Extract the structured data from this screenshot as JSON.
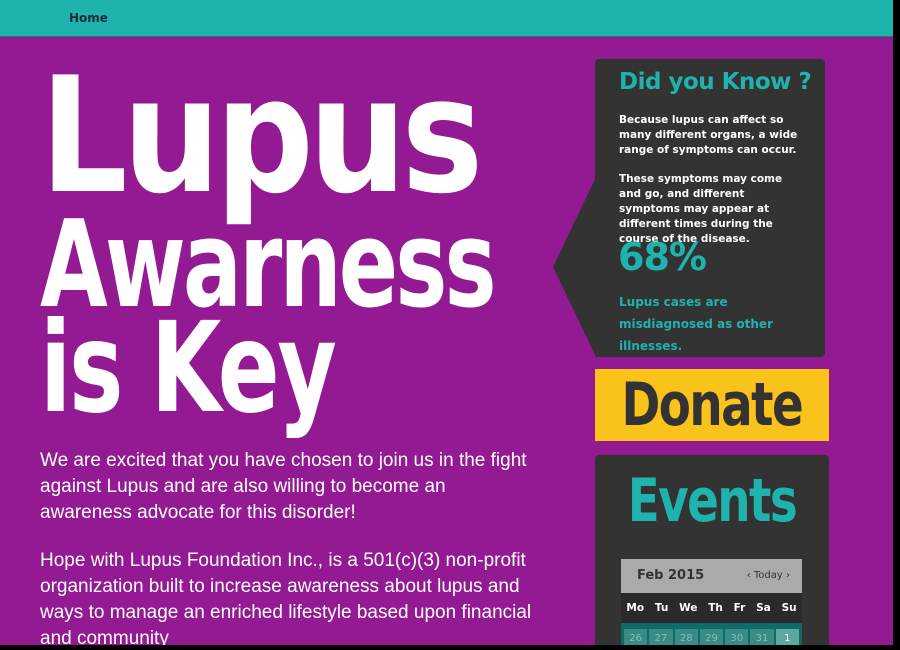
{
  "nav": {
    "home": "Home"
  },
  "hero": {
    "line1": "Lupus",
    "line2": "Awarness",
    "line3": "is Key"
  },
  "intro": {
    "p1": "We are excited that you have chosen to join us in the fight against Lupus and are also willing to become an awareness advocate for this disorder!",
    "p2": "Hope with Lupus Foundation Inc., is a 501(c)(3) non-profit organization built to increase awareness about lupus and ways to manage an enriched lifestyle based upon financial and community"
  },
  "did_you_know": {
    "title": "Did you Know ?",
    "p1": "Because lupus can affect so many different organs, a wide range of symptoms can occur.",
    "p2": "These symptoms may come and go, and different symptoms may appear at different times during the course of the disease.",
    "stat": "68%",
    "stat_label": "Lupus cases are misdiagnosed as other illnesses."
  },
  "donate": {
    "label": "Donate"
  },
  "events": {
    "title": "Events",
    "calendar": {
      "month": "Feb 2015",
      "prev": "‹",
      "today": "Today",
      "next": "›",
      "weekdays": [
        "Mo",
        "Tu",
        "We",
        "Th",
        "Fr",
        "Sa",
        "Su"
      ],
      "dates": [
        "26",
        "27",
        "28",
        "29",
        "30",
        "31",
        "1"
      ]
    }
  },
  "colors": {
    "background": "#931a92",
    "teal": "#1fb3ad",
    "panel": "#333333",
    "donate": "#f9c31c"
  }
}
